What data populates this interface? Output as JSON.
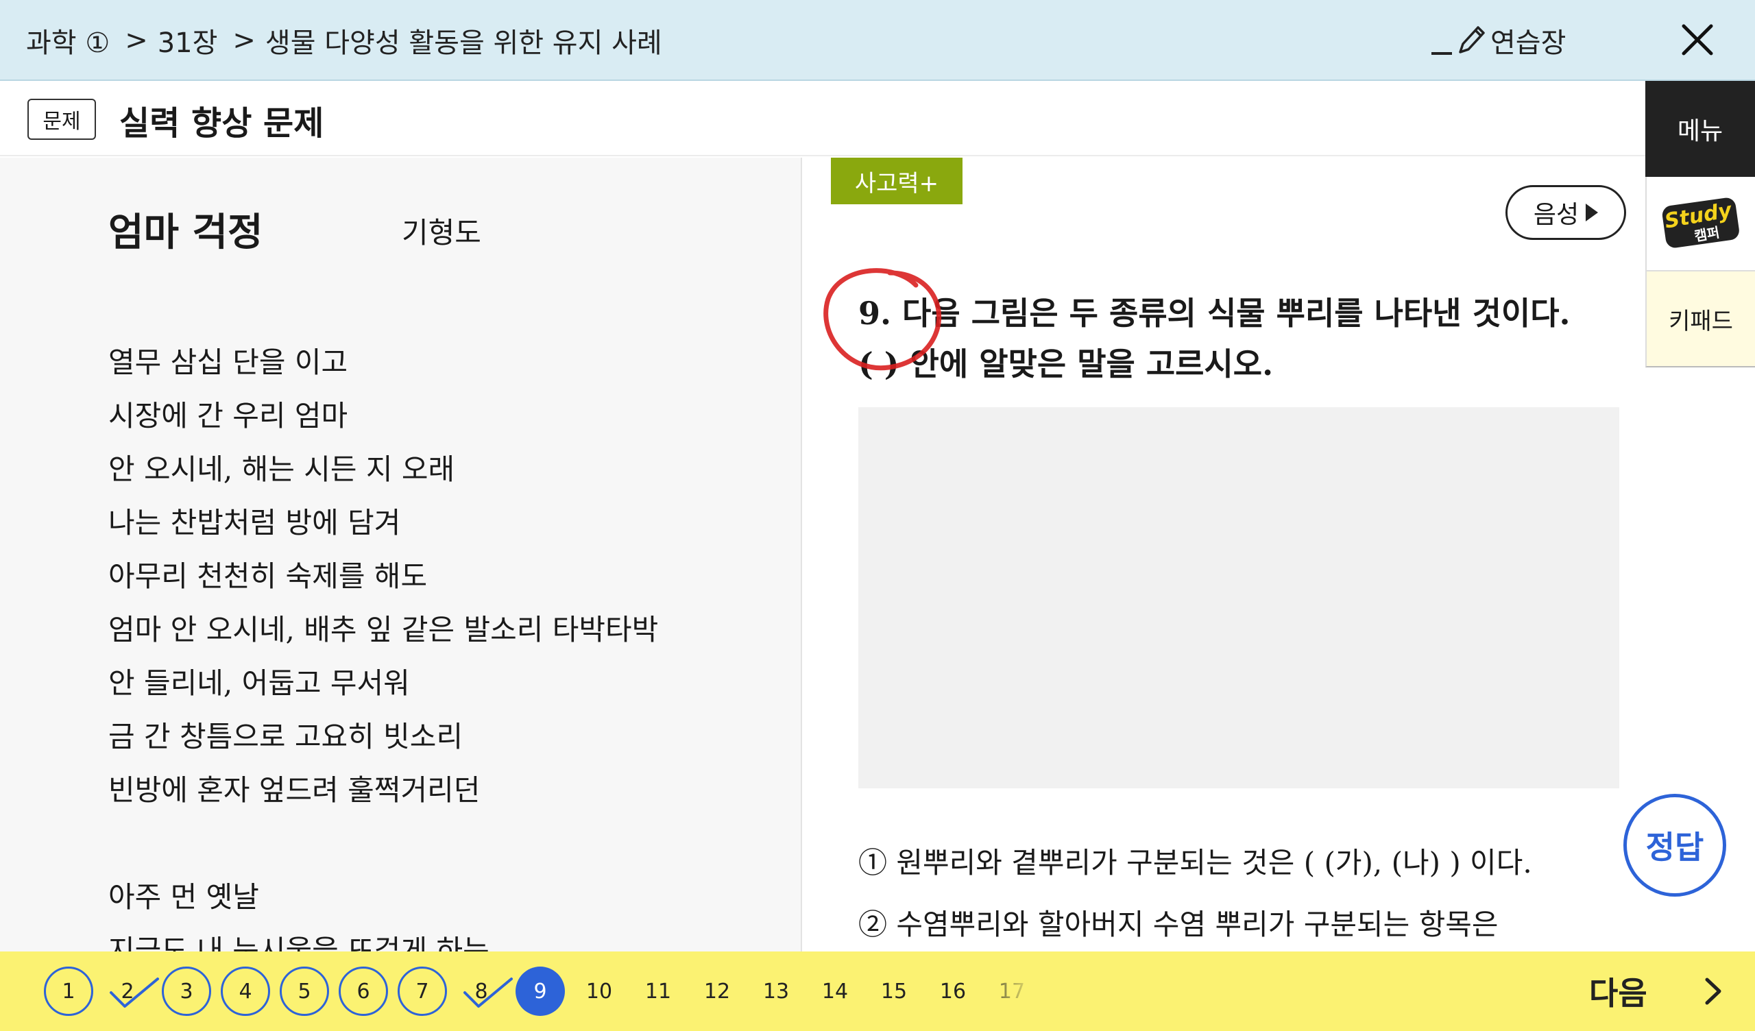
{
  "breadcrumb": {
    "subject": "과학 ①",
    "chapter": "31장",
    "topic": "생물 다양성 활동을 위한 유지 사례"
  },
  "toolbar": {
    "practice_label": "연습장"
  },
  "section": {
    "tag": "문제",
    "title": "실력 향상 문제"
  },
  "side_tabs": {
    "menu": "메뉴",
    "study_logo": "Study 캠퍼",
    "keypad": "키패드"
  },
  "passage": {
    "title": "엄마 걱정",
    "author": "기형도",
    "stanza1": [
      "열무 삼십 단을 이고",
      "시장에 간 우리 엄마",
      "안 오시네, 해는 시든 지 오래",
      "나는 찬밥처럼 방에 담겨",
      "아무리 천천히 숙제를 해도",
      "엄마 안 오시네, 배추 잎 같은 발소리 타박타박",
      "안 들리네, 어둡고 무서워",
      "금 간 창틈으로 고요히 빗소리",
      "빈방에 혼자 엎드려 훌쩍거리던"
    ],
    "stanza2": [
      "아주 먼 옛날",
      "지금도 내 눈시울을 뜨겁게 하는"
    ]
  },
  "question": {
    "badge": "사고력+",
    "audio_label": "음성",
    "line1": "9. 다음 그림은 두 종류의 식물 뿌리를 나타낸 것이다.",
    "line2": "(     ) 안에 알맞은 말을 고르시오.",
    "options": [
      "① 원뿌리와 곁뿌리가 구분되는 것은 ( (가), (나) ) 이다.",
      "② 수염뿌리와 할아버지 수염 뿌리가 구분되는 항목은"
    ],
    "answer_label": "정답"
  },
  "navigation": {
    "pages": [
      {
        "label": "1",
        "state": "done",
        "checked": false
      },
      {
        "label": "2",
        "state": "todo",
        "checked": true
      },
      {
        "label": "3",
        "state": "done",
        "checked": false
      },
      {
        "label": "4",
        "state": "done",
        "checked": false
      },
      {
        "label": "5",
        "state": "done",
        "checked": false
      },
      {
        "label": "6",
        "state": "done",
        "checked": false
      },
      {
        "label": "7",
        "state": "done",
        "checked": false
      },
      {
        "label": "8",
        "state": "todo",
        "checked": true
      },
      {
        "label": "9",
        "state": "current",
        "checked": false
      },
      {
        "label": "10",
        "state": "todo",
        "checked": false
      },
      {
        "label": "11",
        "state": "todo",
        "checked": false
      },
      {
        "label": "12",
        "state": "todo",
        "checked": false
      },
      {
        "label": "13",
        "state": "todo",
        "checked": false
      },
      {
        "label": "14",
        "state": "todo",
        "checked": false
      },
      {
        "label": "15",
        "state": "todo",
        "checked": false
      },
      {
        "label": "16",
        "state": "todo",
        "checked": false
      },
      {
        "label": "17",
        "state": "todo",
        "checked": false
      }
    ],
    "next_label": "다음"
  },
  "colors": {
    "topbar": "#d9ecf3",
    "accent_blue": "#2d63d8",
    "nav_yellow": "#fbf272",
    "badge_green": "#8aa80e",
    "mark_red": "#d92020"
  }
}
